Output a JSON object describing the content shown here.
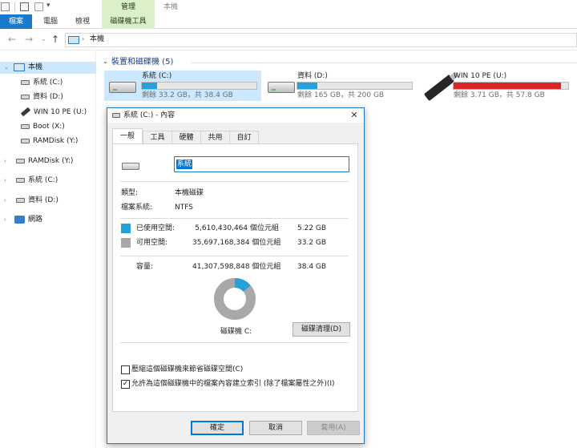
{
  "ribbon": {
    "context_group": "管理",
    "window_title": "本機",
    "tabs": [
      {
        "label": "檔案"
      },
      {
        "label": "電腦"
      },
      {
        "label": "檢視"
      },
      {
        "label": "磁碟機工具"
      }
    ]
  },
  "address": {
    "path": "本機"
  },
  "nav": {
    "this_pc": "本機",
    "items": [
      {
        "label": "系統 (C:)"
      },
      {
        "label": "資料 (D:)"
      },
      {
        "label": "WIN 10 PE (U:)"
      },
      {
        "label": "Boot (X:)"
      },
      {
        "label": "RAMDisk (Y:)"
      },
      {
        "label": "RAMDisk (Y:)"
      },
      {
        "label": "系統 (C:)"
      },
      {
        "label": "資料 (D:)"
      },
      {
        "label": "網路"
      }
    ]
  },
  "content": {
    "group_title": "裝置和磁碟機 (5)",
    "drives": [
      {
        "name": "系統 (C:)",
        "free": "剩餘 33.2 GB，共 38.4 GB",
        "used_fraction": 0.135,
        "bar_color": "#26a0da"
      },
      {
        "name": "資料 (D:)",
        "free": "剩餘 165 GB，共 200 GB",
        "used_fraction": 0.175,
        "bar_color": "#26a0da"
      },
      {
        "name": "WIN 10 PE (U:)",
        "free": "剩餘 3.71 GB，共 57.8 GB",
        "used_fraction": 0.936,
        "bar_color": "#da2626"
      }
    ]
  },
  "dialog": {
    "title": "系統 (C:) - 內容",
    "close_glyph": "✕",
    "tabs": [
      {
        "label": "一般"
      },
      {
        "label": "工具"
      },
      {
        "label": "硬體"
      },
      {
        "label": "共用"
      },
      {
        "label": "自訂"
      }
    ],
    "drive_name": "系統",
    "type_label": "類型:",
    "type_value": "本機磁碟",
    "fs_label": "檔案系統:",
    "fs_value": "NTFS",
    "used_label": "已使用空間:",
    "used_bytes": "5,610,430,464 個位元組",
    "used_gb": "5.22 GB",
    "free_label": "可用空間:",
    "free_bytes": "35,697,168,384 個位元組",
    "free_gb": "33.2 GB",
    "capacity_label": "容量:",
    "capacity_bytes": "41,307,598,848 個位元組",
    "capacity_gb": "38.4 GB",
    "used_fraction": 0.136,
    "used_color": "#26a0da",
    "free_color": "#a8a8a8",
    "drive_label": "磁碟機 C:",
    "cleanup_button": "磁碟清理(D)",
    "compress_option": "壓縮這個磁碟機來節省磁碟空間(C)",
    "compress_checked": "",
    "index_option": "允許為這個磁碟機中的檔案內容建立索引 (除了檔案屬性之外)(I)",
    "index_checked": "✓",
    "ok_button": "確定",
    "cancel_button": "取消",
    "apply_button": "套用(A)"
  }
}
